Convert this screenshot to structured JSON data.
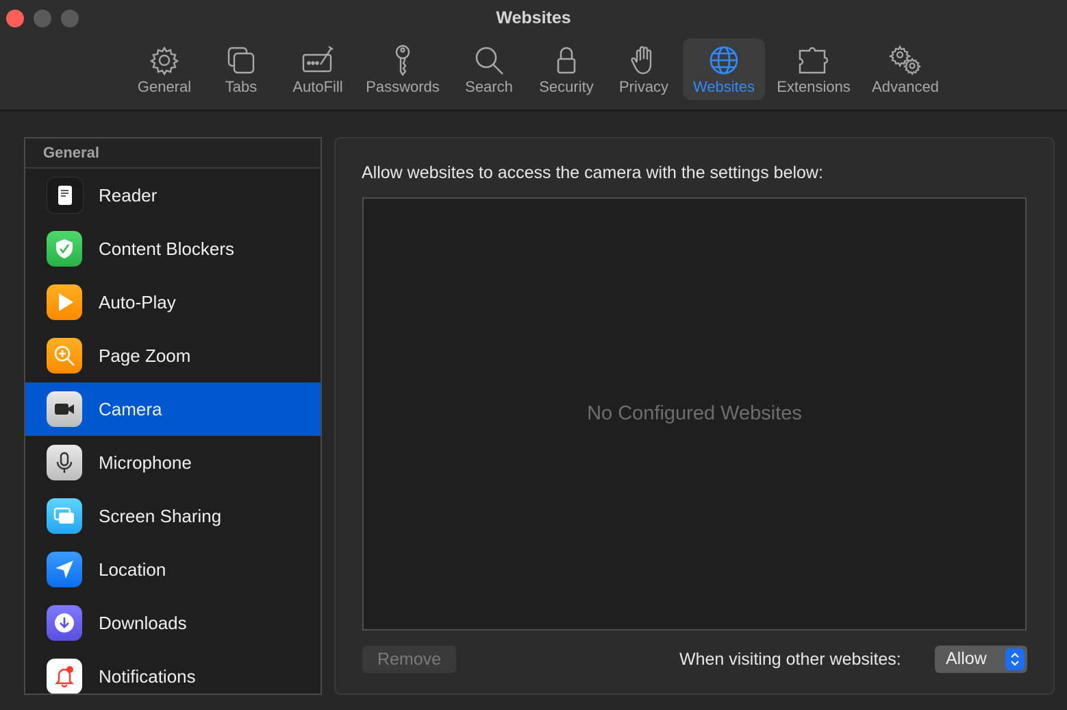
{
  "window": {
    "title": "Websites"
  },
  "toolbar": {
    "tabs": [
      {
        "label": "General",
        "icon": "gear-icon"
      },
      {
        "label": "Tabs",
        "icon": "tabs-icon"
      },
      {
        "label": "AutoFill",
        "icon": "autofill-icon"
      },
      {
        "label": "Passwords",
        "icon": "key-icon"
      },
      {
        "label": "Search",
        "icon": "search-icon"
      },
      {
        "label": "Security",
        "icon": "lock-icon"
      },
      {
        "label": "Privacy",
        "icon": "hand-icon"
      },
      {
        "label": "Websites",
        "icon": "globe-icon",
        "active": true
      },
      {
        "label": "Extensions",
        "icon": "puzzle-icon"
      },
      {
        "label": "Advanced",
        "icon": "gears-icon"
      }
    ],
    "active_color": "#2f8bff"
  },
  "sidebar": {
    "header": "General",
    "items": [
      {
        "label": "Reader",
        "icon": "reader-icon"
      },
      {
        "label": "Content Blockers",
        "icon": "shield-check-icon"
      },
      {
        "label": "Auto-Play",
        "icon": "play-icon"
      },
      {
        "label": "Page Zoom",
        "icon": "zoom-icon"
      },
      {
        "label": "Camera",
        "icon": "camera-icon",
        "selected": true
      },
      {
        "label": "Microphone",
        "icon": "microphone-icon"
      },
      {
        "label": "Screen Sharing",
        "icon": "screen-sharing-icon"
      },
      {
        "label": "Location",
        "icon": "location-icon"
      },
      {
        "label": "Downloads",
        "icon": "download-icon"
      },
      {
        "label": "Notifications",
        "icon": "bell-icon"
      }
    ],
    "selected_color": "#0058d0"
  },
  "panel": {
    "description": "Allow websites to access the camera with the settings below:",
    "empty_message": "No Configured Websites",
    "remove_label": "Remove",
    "default_label": "When visiting other websites:",
    "default_value": "Allow"
  }
}
